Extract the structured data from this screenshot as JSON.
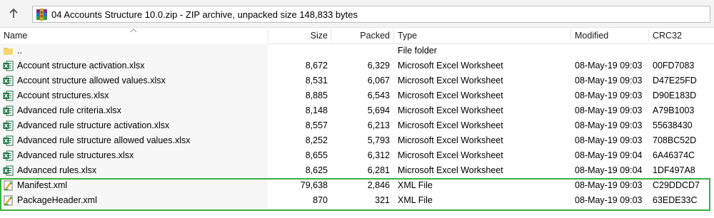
{
  "address_bar": {
    "path_text": "04 Accounts Structure 10.0.zip - ZIP archive, unpacked size 148,833 bytes"
  },
  "columns": {
    "name": "Name",
    "size": "Size",
    "packed": "Packed",
    "type": "Type",
    "modified": "Modified",
    "crc32": "CRC32"
  },
  "files": [
    {
      "icon": "folder-icon",
      "name": "..",
      "size": "",
      "packed": "",
      "type": "File folder",
      "modified": "",
      "crc32": ""
    },
    {
      "icon": "excel-icon",
      "name": "Account structure activation.xlsx",
      "size": "8,672",
      "packed": "6,329",
      "type": "Microsoft Excel Worksheet",
      "modified": "08-May-19 09:03",
      "crc32": "00FD7083"
    },
    {
      "icon": "excel-icon",
      "name": "Account structure allowed values.xlsx",
      "size": "8,531",
      "packed": "6,067",
      "type": "Microsoft Excel Worksheet",
      "modified": "08-May-19 09:03",
      "crc32": "D47E25FD"
    },
    {
      "icon": "excel-icon",
      "name": "Account structures.xlsx",
      "size": "8,885",
      "packed": "6,543",
      "type": "Microsoft Excel Worksheet",
      "modified": "08-May-19 09:03",
      "crc32": "D90E183D"
    },
    {
      "icon": "excel-icon",
      "name": "Advanced rule criteria.xlsx",
      "size": "8,148",
      "packed": "5,694",
      "type": "Microsoft Excel Worksheet",
      "modified": "08-May-19 09:03",
      "crc32": "A79B1003"
    },
    {
      "icon": "excel-icon",
      "name": "Advanced rule structure activation.xlsx",
      "size": "8,557",
      "packed": "6,213",
      "type": "Microsoft Excel Worksheet",
      "modified": "08-May-19 09:03",
      "crc32": "55638430"
    },
    {
      "icon": "excel-icon",
      "name": "Advanced rule structure allowed values.xlsx",
      "size": "8,252",
      "packed": "5,793",
      "type": "Microsoft Excel Worksheet",
      "modified": "08-May-19 09:03",
      "crc32": "708BC52D"
    },
    {
      "icon": "excel-icon",
      "name": "Advanced rule structures.xlsx",
      "size": "8,655",
      "packed": "6,312",
      "type": "Microsoft Excel Worksheet",
      "modified": "08-May-19 09:04",
      "crc32": "6A46374C"
    },
    {
      "icon": "excel-icon",
      "name": "Advanced rules.xlsx",
      "size": "8,625",
      "packed": "6,281",
      "type": "Microsoft Excel Worksheet",
      "modified": "08-May-19 09:04",
      "crc32": "1DF497A8"
    },
    {
      "icon": "xml-icon",
      "name": "Manifest.xml",
      "size": "79,638",
      "packed": "2,846",
      "type": "XML File",
      "modified": "08-May-19 09:03",
      "crc32": "C29DDCD7"
    },
    {
      "icon": "xml-icon",
      "name": "PackageHeader.xml",
      "size": "870",
      "packed": "321",
      "type": "XML File",
      "modified": "08-May-19 09:03",
      "crc32": "63EDE33C"
    }
  ],
  "colors": {
    "highlight_border": "#3cb043",
    "excel_green": "#1e7145"
  }
}
